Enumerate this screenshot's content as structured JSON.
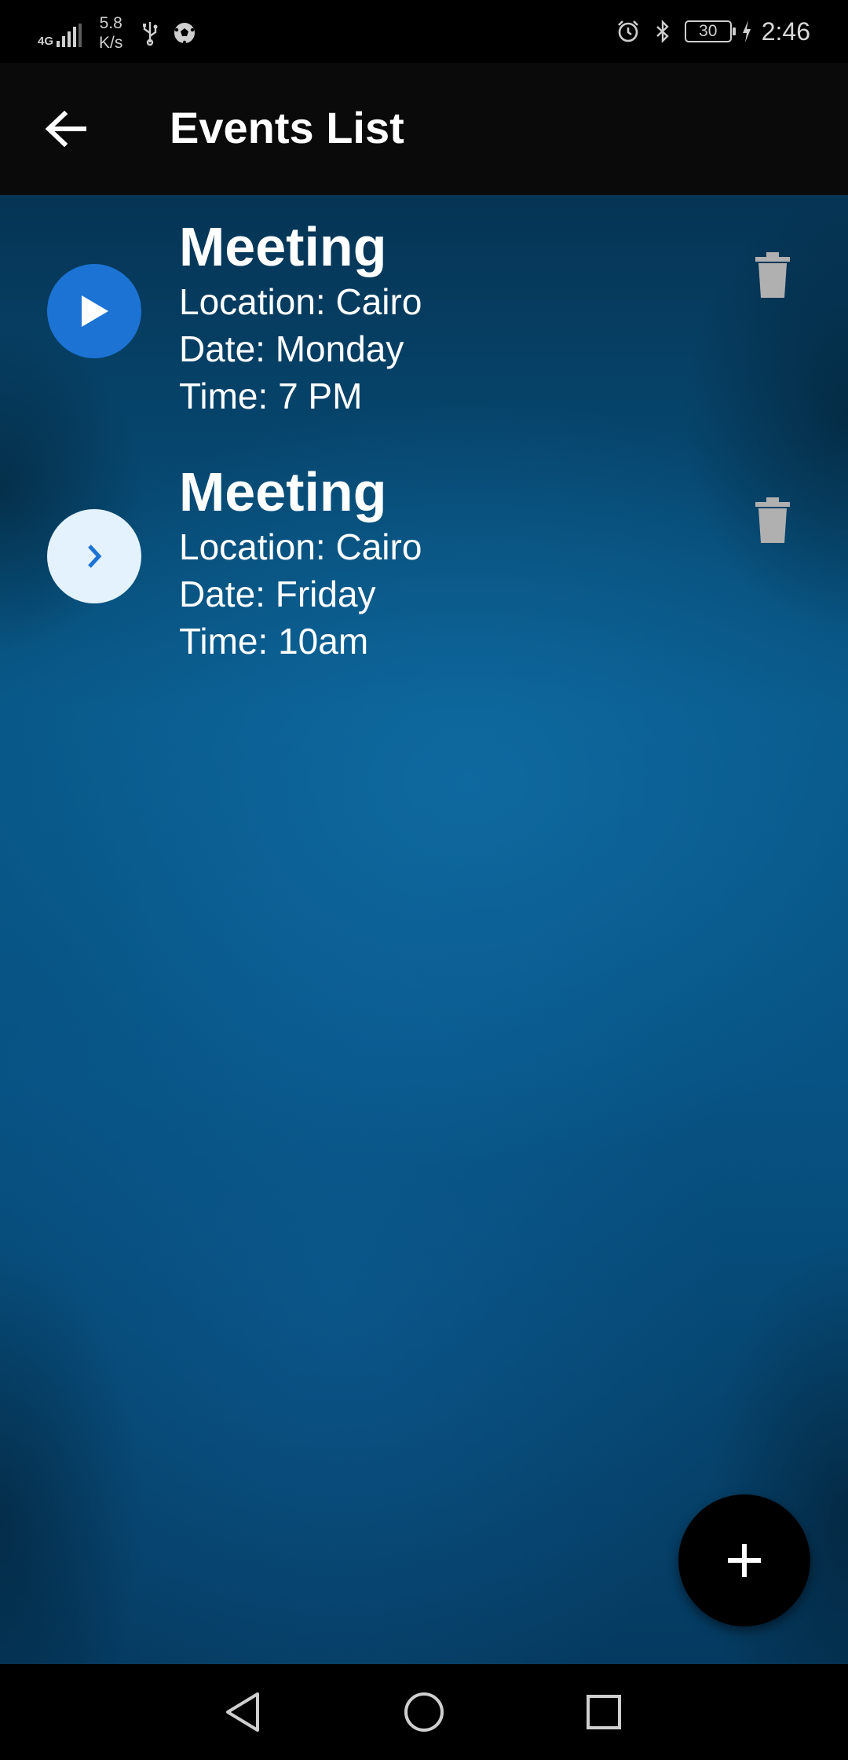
{
  "status_bar": {
    "network_type": "4G",
    "speed_value": "5.8",
    "speed_unit": "K/s",
    "battery_level": "30",
    "time": "2:46",
    "icons": [
      "signal-icon",
      "usb-icon",
      "soccer-ball-icon",
      "alarm-icon",
      "bluetooth-icon",
      "battery-icon",
      "charging-icon"
    ]
  },
  "app_bar": {
    "title": "Events List",
    "back_icon": "arrow-left-icon"
  },
  "events": [
    {
      "title": "Meeting",
      "location": "Location: Cairo",
      "date": "Date: Monday",
      "time": "Time: 7 PM",
      "leading_icon": "play-icon",
      "leading_color": "#1c73d4",
      "trailing_icon": "trash-icon"
    },
    {
      "title": "Meeting",
      "location": "Location: Cairo",
      "date": "Date: Friday",
      "time": "Time: 10am",
      "leading_icon": "chevron-right-icon",
      "leading_color": "#e3f2fd",
      "trailing_icon": "trash-icon"
    }
  ],
  "fab": {
    "icon": "plus-icon",
    "color": "#000000"
  },
  "nav_bar": {
    "buttons": [
      "back-triangle-icon",
      "home-circle-icon",
      "recents-square-icon"
    ]
  },
  "colors": {
    "background_blue": "#075384",
    "app_bar": "#0a0a0a",
    "text": "#ffffff",
    "delete_icon": "#b0b0b0"
  }
}
